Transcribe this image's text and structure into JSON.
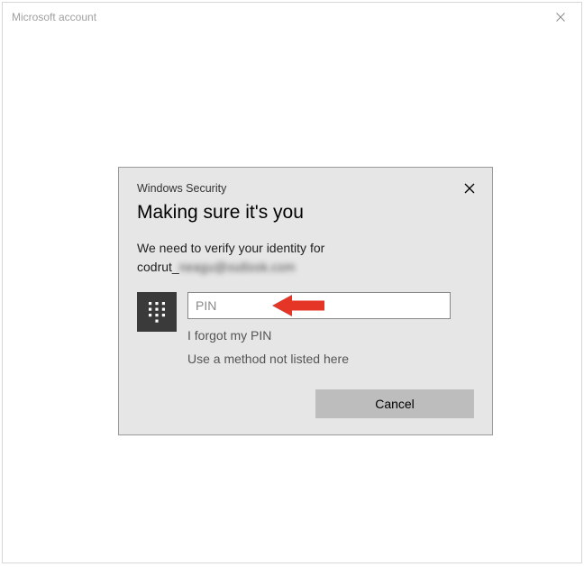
{
  "outer": {
    "title": "Microsoft account"
  },
  "dialog": {
    "title_small": "Windows Security",
    "heading": "Making sure it's you",
    "verify_text": "We need to verify your identity for",
    "email_visible": "codrut_",
    "email_blurred": "neagu@outlook.com",
    "pin_placeholder": "PIN",
    "forgot_pin": "I forgot my PIN",
    "other_method": "Use a method not listed here",
    "cancel": "Cancel"
  }
}
